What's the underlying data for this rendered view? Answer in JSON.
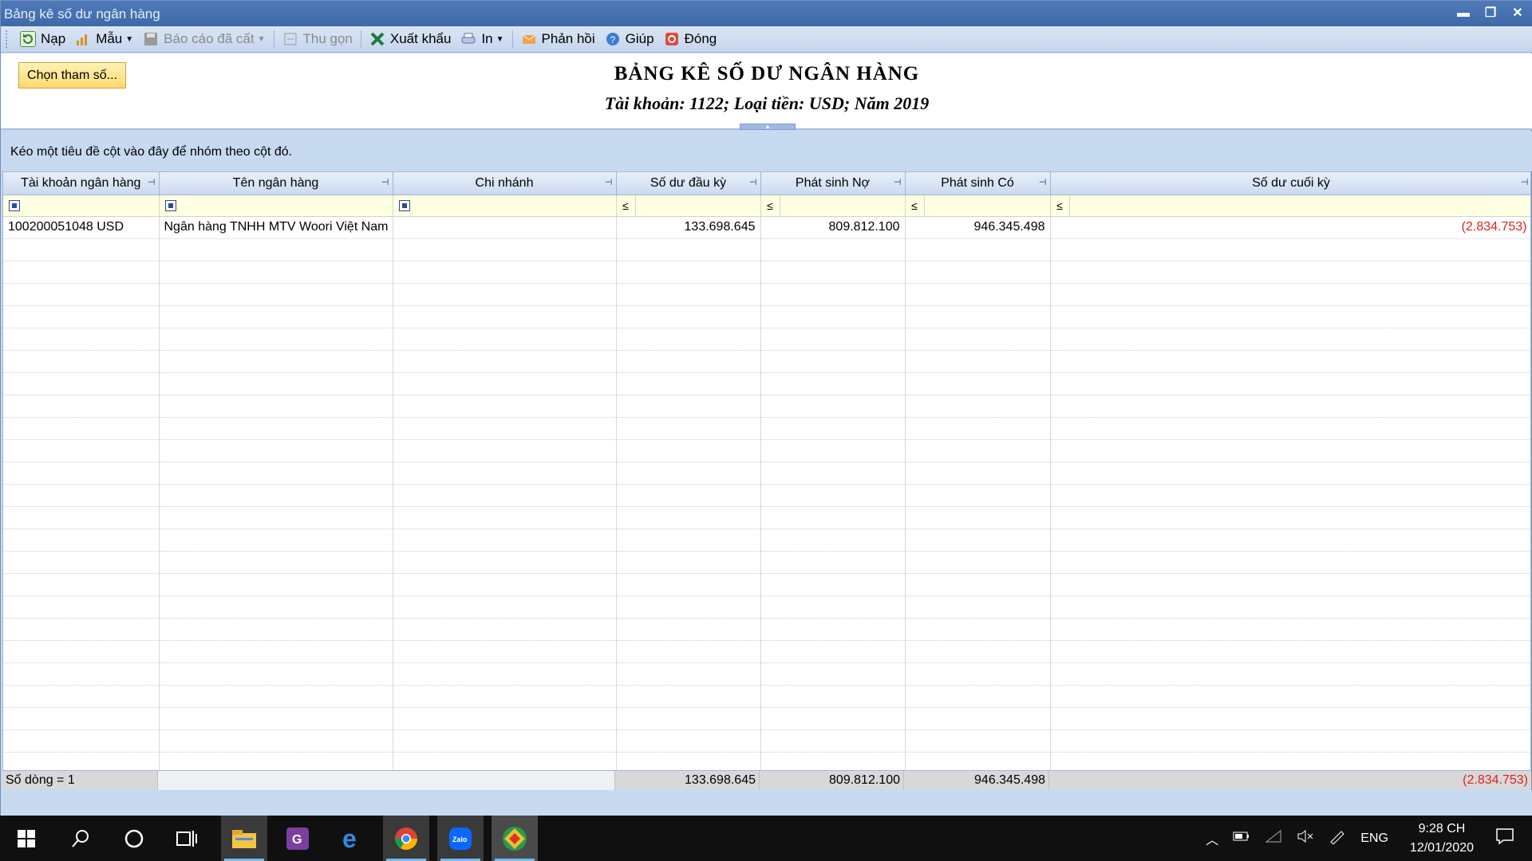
{
  "window": {
    "title": "Bảng kê số dư ngân hàng"
  },
  "toolbar": {
    "nap": "Nạp",
    "mau": "Mẫu",
    "bao_cao_da_cat": "Báo cáo đã cất",
    "thu_gon": "Thu gọn",
    "xuat_khau": "Xuất khẩu",
    "in": "In",
    "phan_hoi": "Phản hồi",
    "giup": "Giúp",
    "dong": "Đóng"
  },
  "header": {
    "param_button": "Chọn tham số...",
    "title": "BẢNG KÊ SỐ DƯ NGÂN HÀNG",
    "subtitle": "Tài khoản: 1122; Loại tiền: USD; Năm 2019"
  },
  "group_panel": {
    "hint": "Kéo một tiêu đề cột vào đây để nhóm theo cột đó."
  },
  "grid": {
    "columns": [
      "Tài khoản ngân hàng",
      "Tên ngân hàng",
      "Chi nhánh",
      "Số dư đầu kỳ",
      "Phát sinh Nợ",
      "Phát sinh Có",
      "Số dư cuối kỳ"
    ],
    "filter_op": "≤",
    "rows": [
      {
        "account": "100200051048 USD",
        "bank": "Ngân hàng TNHH MTV Woori Việt Nam",
        "branch": "",
        "opening": "133.698.645",
        "debit": "809.812.100",
        "credit": "946.345.498",
        "closing": "(2.834.753)"
      }
    ],
    "footer": {
      "count": "Số dòng = 1",
      "opening": "133.698.645",
      "debit": "809.812.100",
      "credit": "946.345.498",
      "closing": "(2.834.753)"
    }
  },
  "taskbar": {
    "language": "ENG",
    "time": "9:28 CH",
    "date": "12/01/2020",
    "apps": [
      "start-icon",
      "search-icon",
      "cortana-icon",
      "task-view-icon",
      "file-explorer-icon",
      "pdf-app-icon",
      "edge-icon",
      "chrome-icon",
      "zalo-icon",
      "accounting-app-icon"
    ]
  },
  "colors": {
    "negative": "#e02020",
    "accent": "#3f6aa9"
  }
}
